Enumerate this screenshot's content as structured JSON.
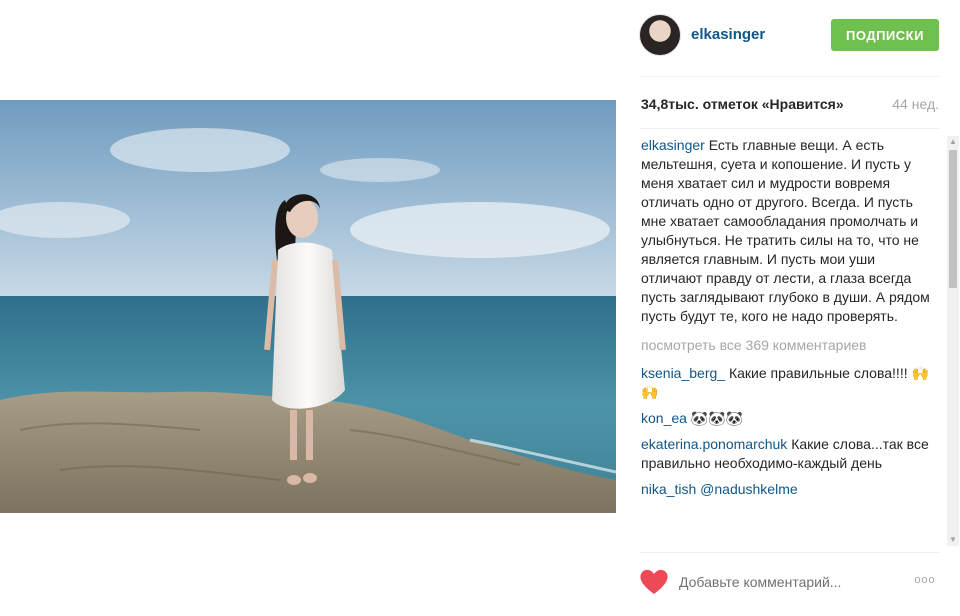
{
  "header": {
    "username": "elkasinger",
    "follow_label": "ПОДПИСКИ"
  },
  "stats": {
    "likes": "34,8тыс. отметок «Нравится»",
    "age": "44 нед."
  },
  "caption": {
    "user": "elkasinger",
    "text": "Есть главные вещи. А есть мельтешня, суета и копошение. И пусть у меня хватает сил и мудрости вовремя отличать одно от другого. Всегда. И пусть мне хватает самообладания промолчать и улыбнуться. Не тратить силы на то, что не является главным. И пусть мои уши отличают правду от лести, а глаза всегда пусть заглядывают глубоко в души. А рядом пусть будут те, кого не надо проверять."
  },
  "view_all": "посмотреть все 369 комментариев",
  "comments": [
    {
      "user": "ksenia_berg_",
      "text": "Какие правильные слова!!!! 🙌🙌"
    },
    {
      "user": "kon_ea",
      "text": "🐼🐼🐼"
    },
    {
      "user": "ekaterina.ponomarchuk",
      "text": "Какие слова...так все правильно необходимо-каждый день"
    },
    {
      "user": "nika_tish",
      "text": "@nadushkelme"
    }
  ],
  "footer": {
    "comment_placeholder": "Добавьте комментарий...",
    "more_label": "ooo"
  },
  "colors": {
    "link": "#125688",
    "follow_button": "#70c050",
    "heart": "#ed4956",
    "muted": "#a5a7aa"
  },
  "icons": {
    "like": "heart-icon",
    "more": "more-options-icon"
  }
}
